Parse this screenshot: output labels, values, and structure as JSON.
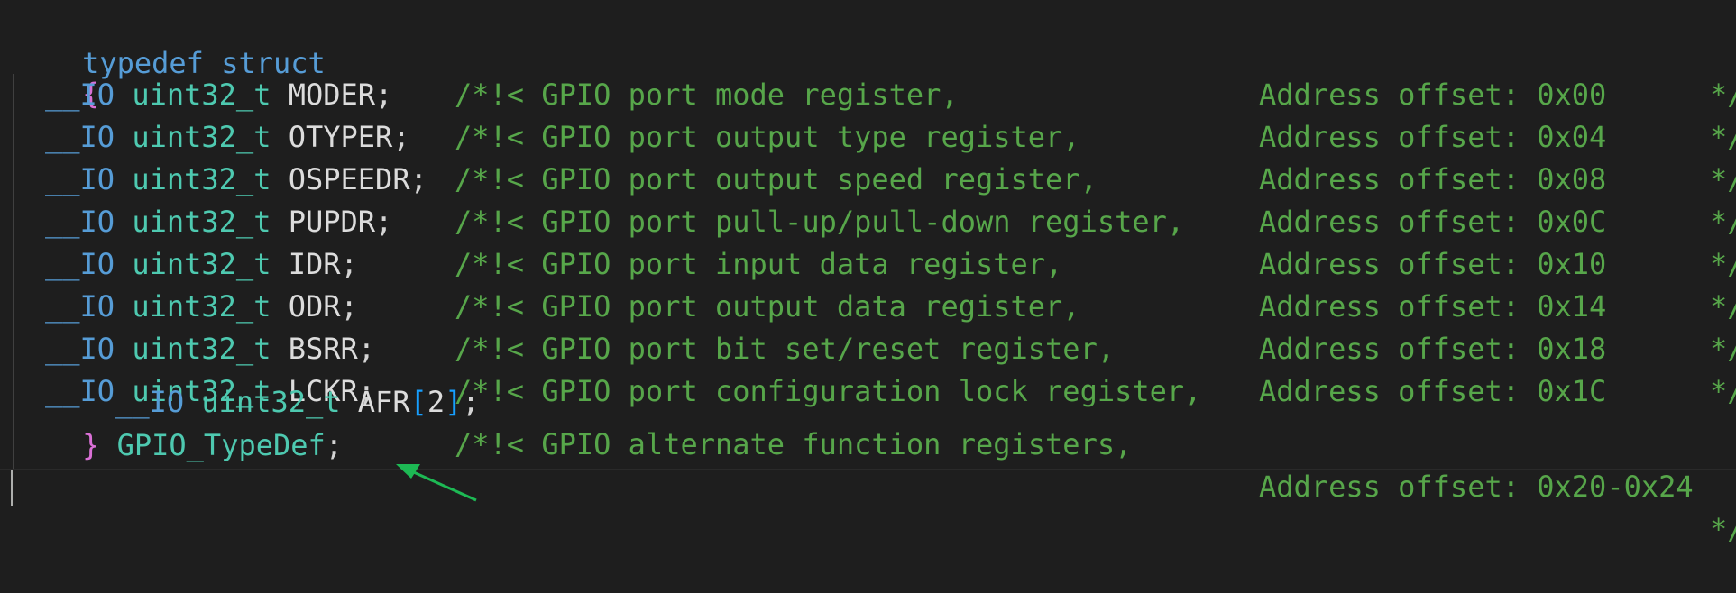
{
  "header": {
    "keyword_typedef": "typedef",
    "keyword_struct": "struct",
    "open_brace": "{"
  },
  "members": [
    {
      "qualifier": "__IO",
      "type": "uint32_t",
      "name": "MODER",
      "suffix": ";",
      "comment": "/*!< GPIO port mode register,",
      "address": "Address offset: 0x00",
      "end": "*/"
    },
    {
      "qualifier": "__IO",
      "type": "uint32_t",
      "name": "OTYPER",
      "suffix": ";",
      "comment": "/*!< GPIO port output type register,",
      "address": "Address offset: 0x04",
      "end": "*/"
    },
    {
      "qualifier": "__IO",
      "type": "uint32_t",
      "name": "OSPEEDR",
      "suffix": ";",
      "comment": "/*!< GPIO port output speed register,",
      "address": "Address offset: 0x08",
      "end": "*/"
    },
    {
      "qualifier": "__IO",
      "type": "uint32_t",
      "name": "PUPDR",
      "suffix": ";",
      "comment": "/*!< GPIO port pull-up/pull-down register,",
      "address": "Address offset: 0x0C",
      "end": "*/"
    },
    {
      "qualifier": "__IO",
      "type": "uint32_t",
      "name": "IDR",
      "suffix": ";",
      "comment": "/*!< GPIO port input data register,",
      "address": "Address offset: 0x10",
      "end": "*/"
    },
    {
      "qualifier": "__IO",
      "type": "uint32_t",
      "name": "ODR",
      "suffix": ";",
      "comment": "/*!< GPIO port output data register,",
      "address": "Address offset: 0x14",
      "end": "*/"
    },
    {
      "qualifier": "__IO",
      "type": "uint32_t",
      "name": "BSRR",
      "suffix": ";",
      "comment": "/*!< GPIO port bit set/reset register,",
      "address": "Address offset: 0x18",
      "end": "*/"
    },
    {
      "qualifier": "__IO",
      "type": "uint32_t",
      "name": "LCKR",
      "suffix": ";",
      "comment": "/*!< GPIO port configuration lock register,",
      "address": "Address offset: 0x1C",
      "end": "*/"
    }
  ],
  "afr": {
    "qualifier": "__IO",
    "type": "uint32_t",
    "name": "AFR",
    "open_bracket": "[",
    "index": "2",
    "close_bracket": "]",
    "suffix": ";",
    "comment": "/*!< GPIO alternate function registers,",
    "address": "Address offset: 0x20-0x24",
    "end": "*/"
  },
  "footer": {
    "close_brace": "}",
    "typedef_name": "GPIO_TypeDef",
    "semicolon": ";"
  },
  "colors": {
    "background": "#1e1e1e",
    "keyword": "#569cd6",
    "type": "#4ec9b0",
    "comment": "#57a64a",
    "brace": "#da70d6",
    "bracket": "#179fff",
    "arrow": "#1db954"
  },
  "annotation": {
    "icon": "arrow-icon",
    "target": "AFR index 2"
  }
}
